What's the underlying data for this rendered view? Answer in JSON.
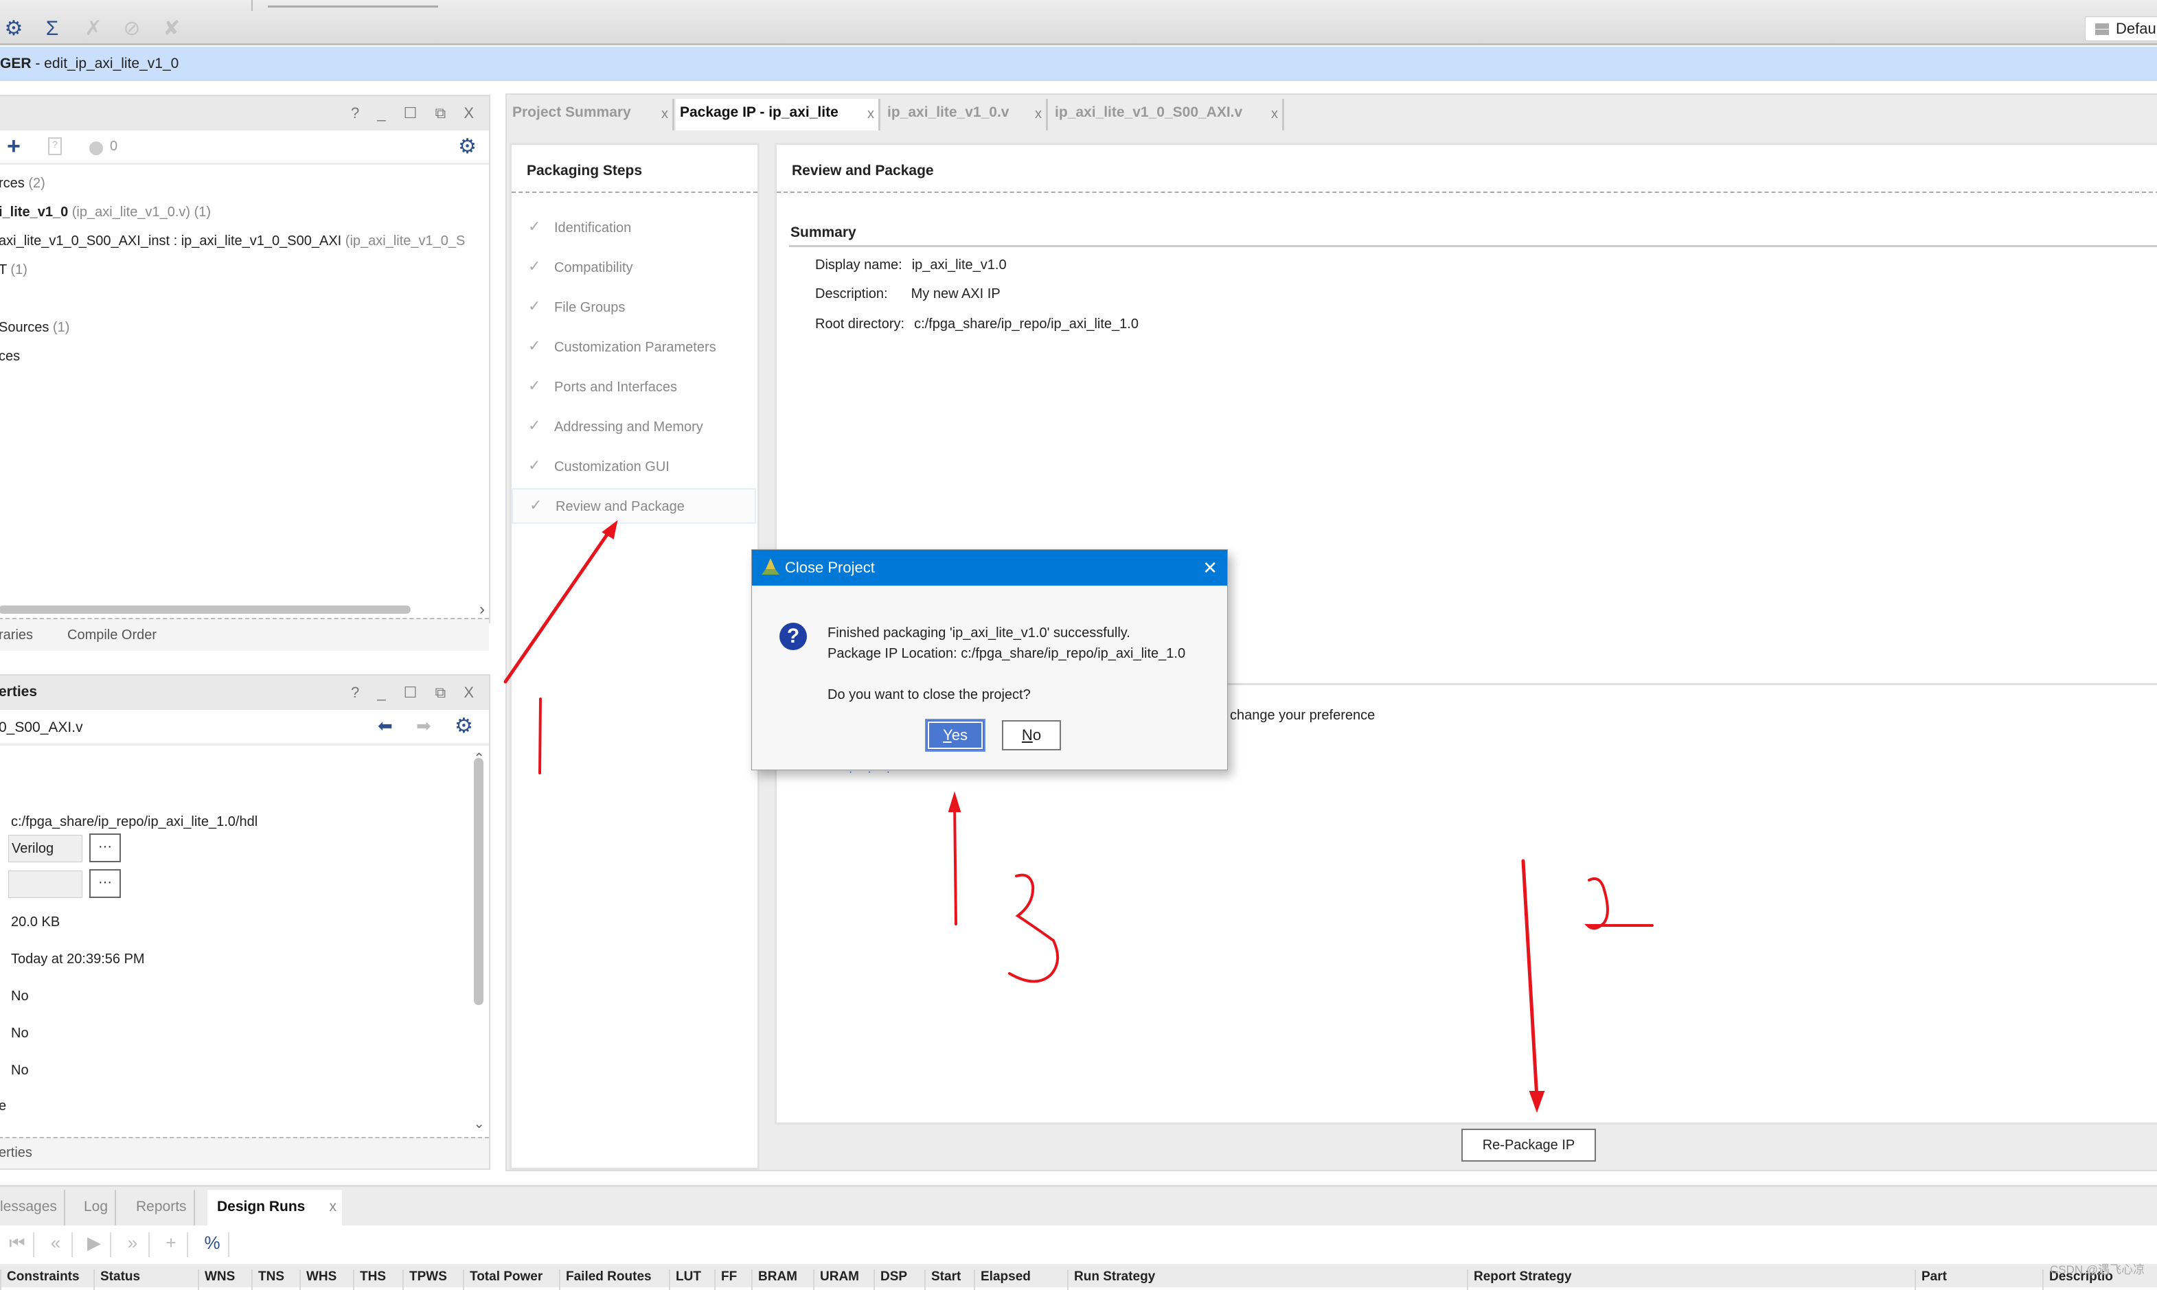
{
  "toolbar": {
    "icons": [
      "settings-icon",
      "sigma-icon",
      "disabled-tool-icon-1",
      "disabled-tool-icon-2",
      "disabled-tool-icon-3"
    ],
    "layout_select": "Default"
  },
  "banner": {
    "prefix": "GER",
    "text": " - edit_ip_axi_lite_v1_0"
  },
  "sources": {
    "controls": "? _ ☐ ⧉ X",
    "issue_count": "0",
    "tree": [
      {
        "main": "rces",
        "extra": " (2)"
      },
      {
        "main": "i_lite_v1_0",
        "extra": " (ip_axi_lite_v1_0.v) (1)"
      },
      {
        "main": "axi_lite_v1_0_S00_AXI_inst : ip_axi_lite_v1_0_S00_AXI",
        "extra": " (ip_axi_lite_v1_0_S"
      },
      {
        "main": "T",
        "extra": " (1)"
      },
      {
        "main": "Sources",
        "extra": " (1)"
      },
      {
        "main": "ces",
        "extra": ""
      }
    ],
    "tabs": [
      "raries",
      "Compile Order"
    ]
  },
  "properties": {
    "title": "erties",
    "controls": "? _ ☐ ⧉ X",
    "file": "0_S00_AXI.v",
    "location": "c:/fpga_share/ip_repo/ip_axi_lite_1.0/hdl",
    "type": "Verilog",
    "library": "",
    "more": "···",
    "size": "20.0 KB",
    "modified": "Today at 20:39:56 PM",
    "flag1": "No",
    "flag2": "No",
    "flag3": "No",
    "cut_label": "e",
    "footer": "erties"
  },
  "editor_tabs": [
    {
      "label": "Project Summary",
      "active": false
    },
    {
      "label": "Package IP - ip_axi_lite",
      "active": true
    },
    {
      "label": "ip_axi_lite_v1_0.v",
      "active": false
    },
    {
      "label": "ip_axi_lite_v1_0_S00_AXI.v",
      "active": false
    }
  ],
  "tab_close": "x",
  "packaging_steps": {
    "title": "Packaging Steps",
    "steps": [
      "Identification",
      "Compatibility",
      "File Groups",
      "Customization Parameters",
      "Ports and Interfaces",
      "Addressing and Memory",
      "Customization GUI",
      "Review and Package"
    ],
    "active_index": 7,
    "check": "✓"
  },
  "review": {
    "title": "Review and Package",
    "summary_title": "Summary",
    "display_name_label": "Display name:",
    "display_name": "ip_axi_lite_v1.0",
    "description_label": "Description:",
    "description": "My new AXI IP",
    "root_label": "Root directory:",
    "root": "c:/fpga_share/ip_repo/ip_axi_lite_1.0",
    "pref_text": "change your preference",
    "repackage_button": "Re-Package IP"
  },
  "bottom": {
    "tabs": [
      "lessages",
      "Log",
      "Reports",
      "Design Runs"
    ],
    "active_tab": "Design Runs",
    "toolbar": [
      "first-icon",
      "previous-icon",
      "run-icon",
      "next-icon",
      "add-icon",
      "percent-icon"
    ],
    "columns": [
      "Constraints",
      "Status",
      "WNS",
      "TNS",
      "WHS",
      "THS",
      "TPWS",
      "Total Power",
      "Failed Routes",
      "LUT",
      "FF",
      "BRAM",
      "URAM",
      "DSP",
      "Start",
      "Elapsed",
      "Run Strategy",
      "Report Strategy",
      "Part",
      "Descriptio"
    ]
  },
  "dialog": {
    "title": "Close Project",
    "close": "✕",
    "line1": "Finished packaging 'ip_axi_lite_v1.0' successfully.",
    "line2": "Package IP Location: c:/fpga_share/ip_repo/ip_axi_lite_1.0",
    "question": "Do you want to close the project?",
    "yes_mnemonic": "Y",
    "yes_rest": "es",
    "no_mnemonic": "N",
    "no_rest": "o"
  },
  "annotations": {
    "labels": [
      "1",
      "2",
      "3"
    ],
    "color": "#e8141c"
  },
  "watermark": "CSDN @遇飞心凉"
}
